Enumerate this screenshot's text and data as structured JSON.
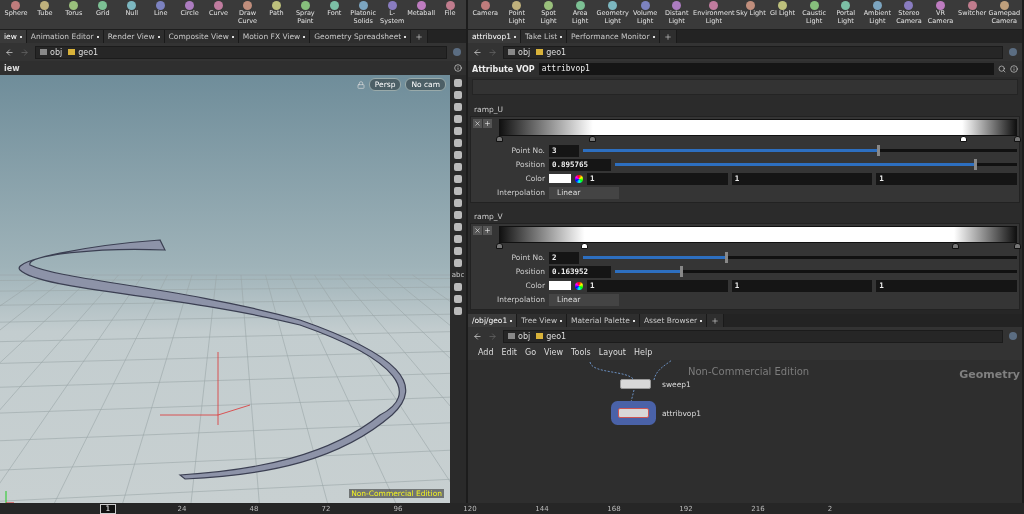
{
  "left_shelf": {
    "tools": [
      {
        "label": "Sphere"
      },
      {
        "label": "Tube"
      },
      {
        "label": "Torus"
      },
      {
        "label": "Grid"
      },
      {
        "label": "Null"
      },
      {
        "label": "Line"
      },
      {
        "label": "Circle"
      },
      {
        "label": "Curve"
      },
      {
        "label": "Draw Curve"
      },
      {
        "label": "Path"
      },
      {
        "label": "Spray Paint"
      },
      {
        "label": "Font"
      },
      {
        "label": "Platonic Solids"
      },
      {
        "label": "L-System"
      },
      {
        "label": "Metaball"
      },
      {
        "label": "File"
      }
    ]
  },
  "right_shelf": {
    "tools": [
      {
        "label": "Camera"
      },
      {
        "label": "Point Light"
      },
      {
        "label": "Spot Light"
      },
      {
        "label": "Area Light"
      },
      {
        "label": "Geometry Light"
      },
      {
        "label": "Volume Light"
      },
      {
        "label": "Distant Light"
      },
      {
        "label": "Environment Light"
      },
      {
        "label": "Sky Light"
      },
      {
        "label": "GI Light"
      },
      {
        "label": "Caustic Light"
      },
      {
        "label": "Portal Light"
      },
      {
        "label": "Ambient Light"
      },
      {
        "label": "Stereo Camera"
      },
      {
        "label": "VR Camera"
      },
      {
        "label": "Switcher"
      },
      {
        "label": "Gamepad Camera"
      }
    ]
  },
  "viewer_pane": {
    "tabs": [
      {
        "label": "iew",
        "selected": true
      },
      {
        "label": "Animation Editor",
        "selected": false
      },
      {
        "label": "Render View",
        "selected": false
      },
      {
        "label": "Composite View",
        "selected": false
      },
      {
        "label": "Motion FX View",
        "selected": false
      },
      {
        "label": "Geometry Spreadsheet",
        "selected": false
      }
    ],
    "path": [
      "obj",
      "geo1"
    ],
    "title": "iew",
    "view_menus": [
      "Persp",
      "No cam"
    ],
    "toolbar_text": "abc",
    "watermark": "Non-Commercial Edition"
  },
  "parameter_pane": {
    "tabs": [
      {
        "label": "attribvop1",
        "selected": true
      },
      {
        "label": "Take List",
        "selected": false
      },
      {
        "label": "Performance Monitor",
        "selected": false
      }
    ],
    "path": [
      "obj",
      "geo1"
    ],
    "node_type": "Attribute VOP",
    "node_name": "attribvop1",
    "ramps": [
      {
        "name": "ramp_U",
        "keys": [
          {
            "level": 0,
            "selected": false
          },
          {
            "level": 0.18,
            "selected": false
          },
          {
            "level": 0.895765,
            "selected": true
          },
          {
            "level": 1,
            "selected": false
          }
        ],
        "params": [
          {
            "kind": "slider",
            "label": "Point No.",
            "value": "3",
            "level": 0.68
          },
          {
            "kind": "slider",
            "label": "Position",
            "value": "0.895765",
            "level": 0.895765
          },
          {
            "kind": "color",
            "label": "Color",
            "values": [
              "1",
              "1",
              "1"
            ]
          },
          {
            "kind": "menu",
            "label": "Interpolation",
            "value": "Linear"
          }
        ]
      },
      {
        "name": "ramp_V",
        "keys": [
          {
            "level": 0,
            "selected": false
          },
          {
            "level": 0.163952,
            "selected": true
          },
          {
            "level": 0.88,
            "selected": false
          },
          {
            "level": 1,
            "selected": false
          }
        ],
        "params": [
          {
            "kind": "slider",
            "label": "Point No.",
            "value": "2",
            "level": 0.33
          },
          {
            "kind": "slider",
            "label": "Position",
            "value": "0.163952",
            "level": 0.163952
          },
          {
            "kind": "color",
            "label": "Color",
            "values": [
              "1",
              "1",
              "1"
            ]
          },
          {
            "kind": "menu",
            "label": "Interpolation",
            "value": "Linear"
          }
        ]
      }
    ]
  },
  "network_pane": {
    "tabs": [
      {
        "label": "/obj/geo1",
        "selected": true
      },
      {
        "label": "Tree View",
        "selected": false
      },
      {
        "label": "Material Palette",
        "selected": false
      },
      {
        "label": "Asset Browser",
        "selected": false
      }
    ],
    "path": [
      "obj",
      "geo1"
    ],
    "menu": [
      "Add",
      "Edit",
      "Go",
      "View",
      "Tools",
      "Layout",
      "Help"
    ],
    "watermark": "Non-Commercial Edition",
    "context": "Geometry",
    "nodes": [
      {
        "name": "sweep1",
        "kind": "sop"
      },
      {
        "name": "attribvop1",
        "kind": "vop"
      }
    ]
  },
  "timeline": {
    "frame": "1",
    "ticks": [
      "24",
      "48",
      "72",
      "96",
      "120",
      "144",
      "168",
      "192",
      "216",
      "2"
    ]
  }
}
